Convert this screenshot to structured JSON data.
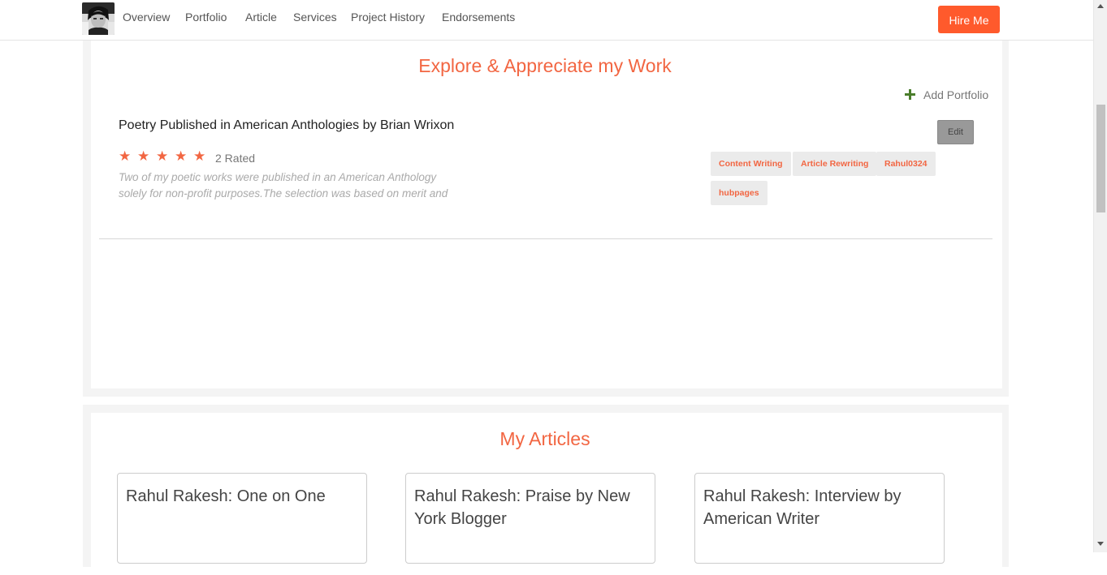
{
  "nav": {
    "links": [
      "Overview",
      "Portfolio",
      "Article",
      "Services",
      "Project History",
      "Endorsements"
    ],
    "hire_label": "Hire Me"
  },
  "portfolio_section": {
    "title": "Explore & Appreciate my Work",
    "add_label": "Add Portfolio",
    "item": {
      "title": "Poetry Published in American Anthologies by Brian Wrixon",
      "stars": 5,
      "rated": "2 Rated",
      "description": "Two of my poetic works were published in an American Anthology solely for non-profit purposes.The selection was based on merit and quality of work. The work is shown and shared with people for non-profit purposes",
      "edit_label": "Edit",
      "tags": [
        "Content Writing",
        "Article Rewriting",
        "Rahul0324",
        "hubpages"
      ]
    }
  },
  "articles_section": {
    "title": "My Articles",
    "articles": [
      "Rahul Rakesh: One on One",
      "Rahul Rakesh: Praise by New York Blogger",
      "Rahul Rakesh: Interview by American Writer"
    ]
  },
  "colors": {
    "accent": "#f26642",
    "hire_button": "#ff5a2c",
    "plus_icon": "#4a7d2b",
    "section_bg": "#f4f4f4"
  },
  "icons": [
    "avatar-photo",
    "plus-icon",
    "star-icon"
  ]
}
